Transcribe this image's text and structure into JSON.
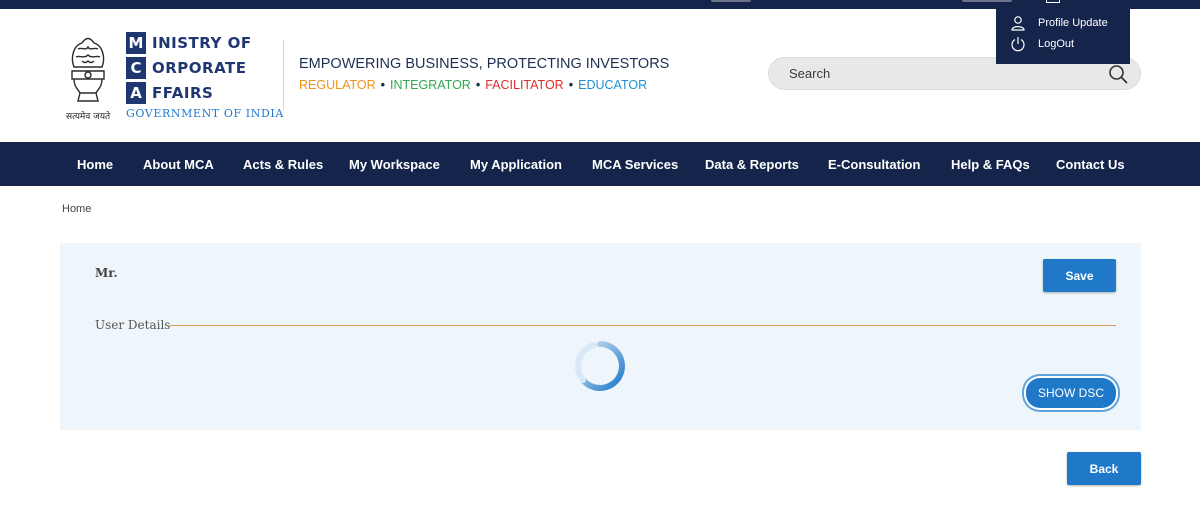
{
  "header": {
    "emblem_caption": "सत्यमेव जयते",
    "logo_letters": [
      "M",
      "C",
      "A"
    ],
    "logo_words": [
      "INISTRY OF",
      "ORPORATE",
      "FFAIRS"
    ],
    "gov_label": "GOVERNMENT OF INDIA",
    "tagline": "EMPOWERING BUSINESS, PROTECTING INVESTORS",
    "roles": [
      {
        "label": "REGULATOR",
        "color": "#f0921e"
      },
      {
        "label": "INTEGRATOR",
        "color": "#2fa84f"
      },
      {
        "label": "FACILITATOR",
        "color": "#e02b2b"
      },
      {
        "label": "EDUCATOR",
        "color": "#1f90d0"
      }
    ],
    "search_placeholder": "Search"
  },
  "profile_menu": {
    "items": [
      {
        "label": "Profile Update",
        "icon": "user-icon"
      },
      {
        "label": "LogOut",
        "icon": "power-icon"
      }
    ]
  },
  "nav": {
    "items": [
      "Home",
      "About MCA",
      "Acts & Rules",
      "My Workspace",
      "My Application",
      "MCA Services",
      "Data & Reports",
      "E-Consultation",
      "Help & FAQs",
      "Contact Us"
    ]
  },
  "breadcrumb": "Home",
  "form": {
    "salutation": "Mr.",
    "save_label": "Save",
    "section_label": "User Details",
    "show_dsc_label": "SHOW DSC",
    "back_label": "Back"
  },
  "colors": {
    "navy": "#14244a",
    "primary_button": "#1f78c8",
    "panel_bg": "#eef6fc",
    "section_rule": "#d49a58"
  }
}
